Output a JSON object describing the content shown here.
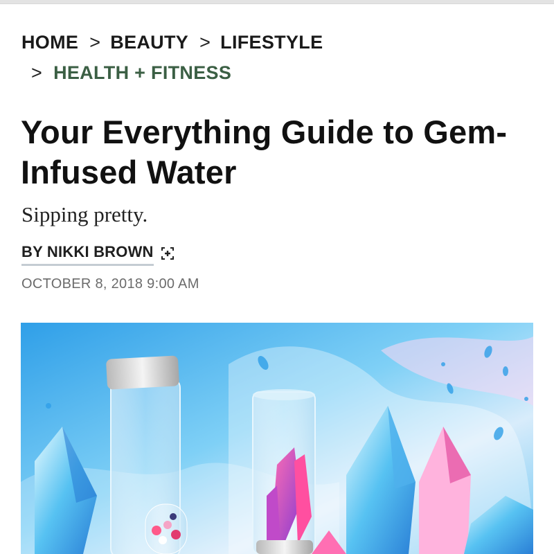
{
  "breadcrumb": {
    "items": [
      "HOME",
      "BEAUTY",
      "LIFESTYLE",
      "HEALTH + FITNESS"
    ],
    "separator": ">",
    "active_color": "#3b5f44"
  },
  "article": {
    "title": "Your Everything Guide to Gem-Infused Water",
    "dek": "Sipping pretty.",
    "byline": "BY NIKKI BROWN",
    "date": "OCTOBER 8, 2018 9:00 AM",
    "follow_icon": "follow-author-icon"
  },
  "hero": {
    "subject": "illustration of glass water bottles with colorful crystals",
    "palette": [
      "#3ea7ea",
      "#8fd3f7",
      "#ffffff",
      "#e93e8e",
      "#7b5cc9"
    ]
  }
}
